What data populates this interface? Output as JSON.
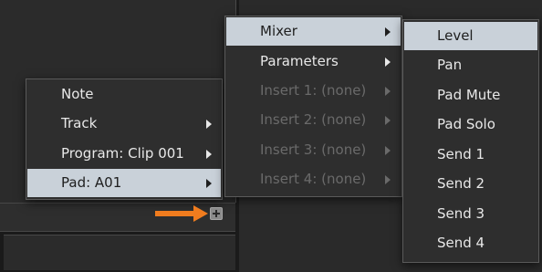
{
  "context_menu": {
    "items": [
      {
        "label": "Note",
        "submenu": false,
        "selected": false,
        "disabled": false
      },
      {
        "label": "Track",
        "submenu": true,
        "selected": false,
        "disabled": false
      },
      {
        "label": "Program: Clip 001",
        "submenu": true,
        "selected": false,
        "disabled": false
      },
      {
        "label": "Pad: A01",
        "submenu": true,
        "selected": true,
        "disabled": false
      }
    ]
  },
  "pad_submenu": {
    "items": [
      {
        "label": "Mixer",
        "submenu": true,
        "selected": true,
        "disabled": false
      },
      {
        "label": "Parameters",
        "submenu": true,
        "selected": false,
        "disabled": false
      },
      {
        "label": "Insert 1: (none)",
        "submenu": true,
        "selected": false,
        "disabled": true
      },
      {
        "label": "Insert 2: (none)",
        "submenu": true,
        "selected": false,
        "disabled": true
      },
      {
        "label": "Insert 3: (none)",
        "submenu": true,
        "selected": false,
        "disabled": true
      },
      {
        "label": "Insert 4: (none)",
        "submenu": true,
        "selected": false,
        "disabled": true
      }
    ]
  },
  "mixer_submenu": {
    "items": [
      {
        "label": "Level",
        "selected": true
      },
      {
        "label": "Pan",
        "selected": false
      },
      {
        "label": "Pad Mute",
        "selected": false
      },
      {
        "label": "Pad Solo",
        "selected": false
      },
      {
        "label": "Send 1",
        "selected": false
      },
      {
        "label": "Send 2",
        "selected": false
      },
      {
        "label": "Send 3",
        "selected": false
      },
      {
        "label": "Send 4",
        "selected": false
      }
    ]
  },
  "icons": {
    "add_button": "plus-icon",
    "pointer_arrow": "arrow-right-icon",
    "submenu_arrow": "triangle-right-icon"
  },
  "colors": {
    "highlight": "#c9d1d9",
    "pointer_arrow": "#f07c1e",
    "disabled_text": "#6a6a6a"
  }
}
